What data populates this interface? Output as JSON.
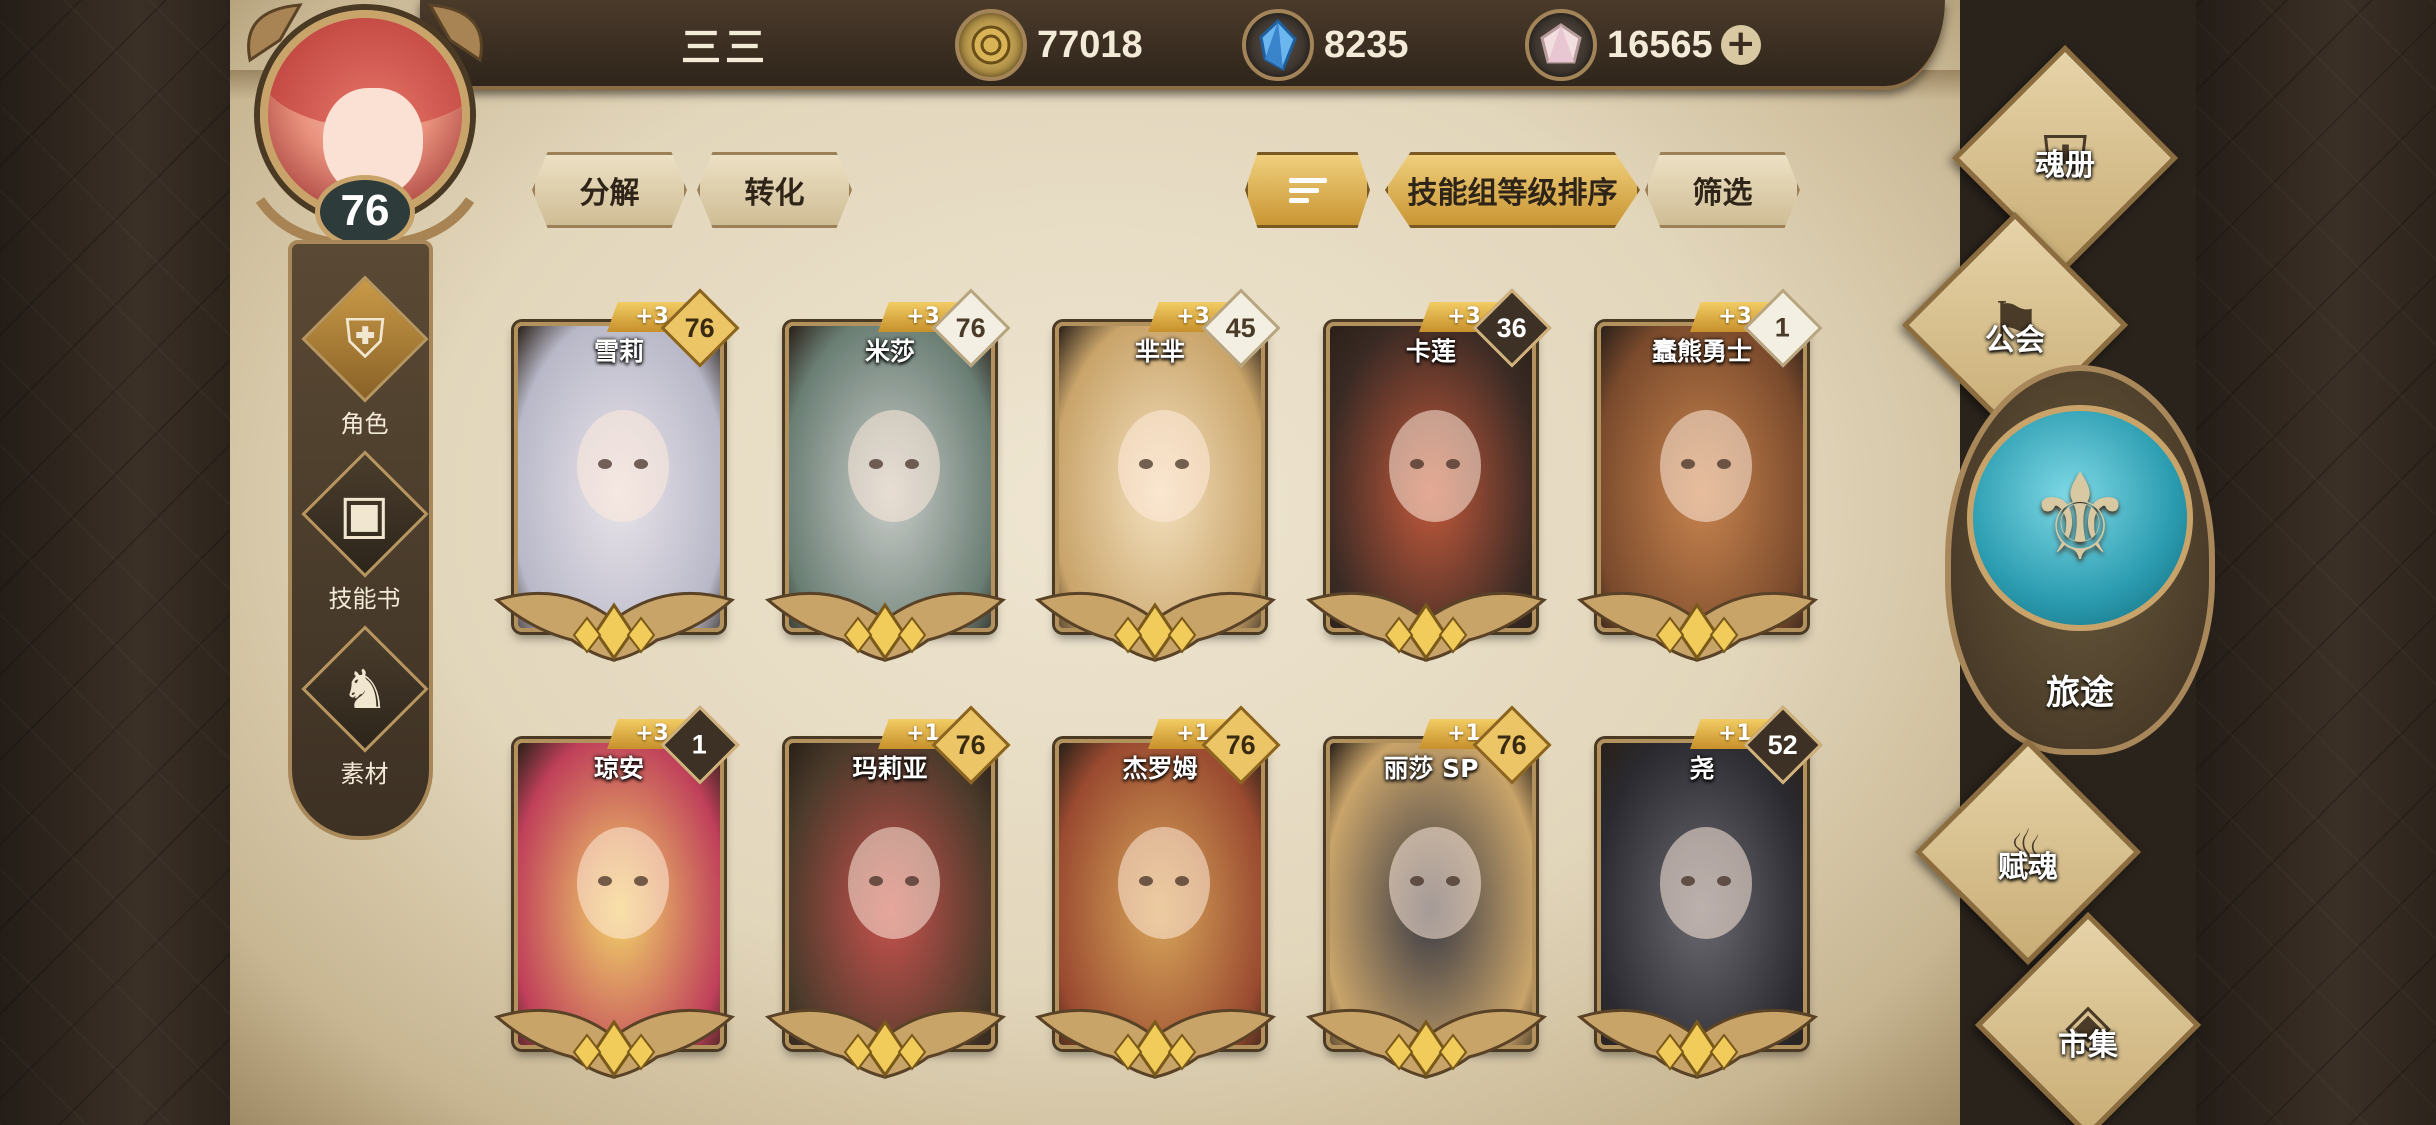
{
  "player": {
    "name": "三三",
    "level": "76"
  },
  "currencies": [
    {
      "icon": "gold-coin-icon",
      "value": "77018",
      "color": "#c9a34e"
    },
    {
      "icon": "blue-crystal-icon",
      "value": "8235",
      "color": "#5b9fd8"
    },
    {
      "icon": "pink-gem-icon",
      "value": "16565",
      "color": "#e9c8c8",
      "has_plus": true
    }
  ],
  "toolbar": {
    "decompose": "分解",
    "convert": "转化",
    "sort_icon": "sort-icon",
    "sort_label": "技能组等级排序",
    "filter": "筛选"
  },
  "left_nav": [
    {
      "icon": "helmet-icon",
      "label": "角色",
      "active": true
    },
    {
      "icon": "skill-book-icon",
      "label": "技能书",
      "active": false
    },
    {
      "icon": "beast-head-icon",
      "label": "素材",
      "active": false
    }
  ],
  "right_nav": {
    "soul_book": "魂册",
    "guild": "公会",
    "journey": "旅途",
    "endow_soul": "赋魂",
    "market": "市集"
  },
  "heroes": [
    {
      "name": "雪莉",
      "plus": "+3",
      "level": "76",
      "badge": "gold",
      "palette": [
        "#e9e4ea",
        "#b8b8c8"
      ]
    },
    {
      "name": "米莎",
      "plus": "+3",
      "level": "76",
      "badge": "light",
      "palette": [
        "#c9ccc8",
        "#6a7e74"
      ]
    },
    {
      "name": "芈芈",
      "plus": "+3",
      "level": "45",
      "badge": "light",
      "palette": [
        "#f4e1bf",
        "#c9a46a"
      ]
    },
    {
      "name": "卡莲",
      "plus": "+3",
      "level": "36",
      "badge": "dark",
      "palette": [
        "#c45a3c",
        "#3a2a24"
      ]
    },
    {
      "name": "蠢熊勇士",
      "plus": "+3",
      "level": "1",
      "badge": "light",
      "palette": [
        "#c9854f",
        "#7a4a2c"
      ]
    },
    {
      "name": "琼安",
      "plus": "+3",
      "level": "1",
      "badge": "dark",
      "palette": [
        "#f1d46a",
        "#c0405a"
      ]
    },
    {
      "name": "玛莉亚",
      "plus": "+1",
      "level": "76",
      "badge": "gold",
      "palette": [
        "#c9524e",
        "#4a3a2a"
      ]
    },
    {
      "name": "杰罗姆",
      "plus": "+1",
      "level": "76",
      "badge": "gold",
      "palette": [
        "#d8a65a",
        "#9a4a30"
      ]
    },
    {
      "name": "丽莎 SP",
      "plus": "+1",
      "level": "76",
      "badge": "gold",
      "palette": [
        "#3a3a44",
        "#c9a46a"
      ]
    },
    {
      "name": "尧",
      "plus": "+1",
      "level": "52",
      "badge": "dark",
      "palette": [
        "#6a6a70",
        "#2a2a30"
      ]
    }
  ]
}
